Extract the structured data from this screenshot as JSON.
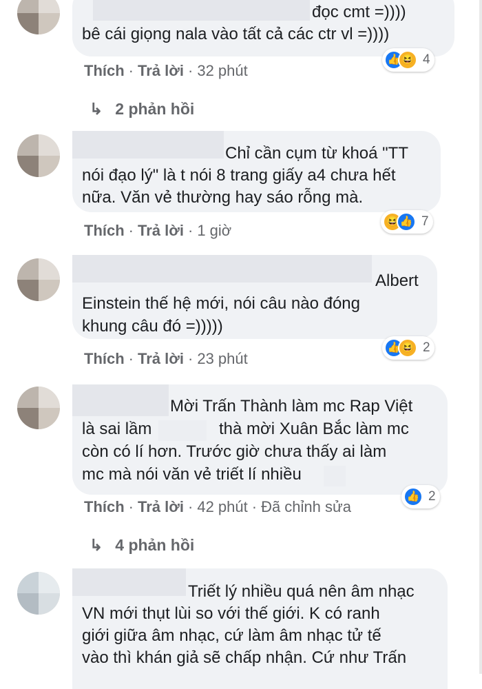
{
  "comments": [
    {
      "text_lines": [
        "đọc cmt =))))",
        "bê cái giọng nala vào tất cả các ctr vl =))))"
      ],
      "actions": {
        "like": "Thích",
        "reply": "Trả lời",
        "time": "32 phút"
      },
      "reactions": {
        "icons": [
          "like-icon",
          "haha-icon"
        ],
        "count": "4"
      },
      "replies": "2 phản hồi"
    },
    {
      "text_lines": [
        "Chỉ cần cụm từ khoá \"TT",
        "nói đạo lý\" là t nói 8 trang giấy a4 chưa hết",
        "nữa. Văn vẻ thường hay sáo rỗng mà."
      ],
      "actions": {
        "like": "Thích",
        "reply": "Trả lời",
        "time": "1 giờ"
      },
      "reactions": {
        "icons": [
          "haha-icon",
          "like-icon"
        ],
        "count": "7"
      }
    },
    {
      "text_lines": [
        "Albert",
        "Einstein thế hệ mới, nói câu nào đóng",
        "khung câu đó =)))))"
      ],
      "actions": {
        "like": "Thích",
        "reply": "Trả lời",
        "time": "23 phút"
      },
      "reactions": {
        "icons": [
          "like-icon",
          "haha-icon"
        ],
        "count": "2"
      }
    },
    {
      "text_lines": [
        "Mời Trấn Thành làm mc Rap Việt",
        "là sai lầm",
        "thà mời Xuân Bắc làm mc",
        "còn có lí hơn. Trước giờ chưa thấy ai làm",
        "mc mà nói văn vẻ triết lí nhiều"
      ],
      "actions": {
        "like": "Thích",
        "reply": "Trả lời",
        "time": "42 phút",
        "edited": "Đã chỉnh sửa"
      },
      "reactions": {
        "icons": [
          "like-icon"
        ],
        "count": "2"
      },
      "replies": "4 phản hồi"
    },
    {
      "text_lines": [
        "Triết lý nhiều quá nên âm nhạc",
        "VN mới thụt lùi so với thế giới. K có ranh",
        "giới giữa âm nhạc, cứ làm âm nhạc tử tế",
        "vào thì khán giả sẽ chấp nhận. Cứ như Trấn"
      ]
    }
  ],
  "separator": "·",
  "colors": {
    "bubble": "#f0f2f5",
    "like": "#1877f2",
    "haha": "#f7b125",
    "meta": "#65676b"
  }
}
